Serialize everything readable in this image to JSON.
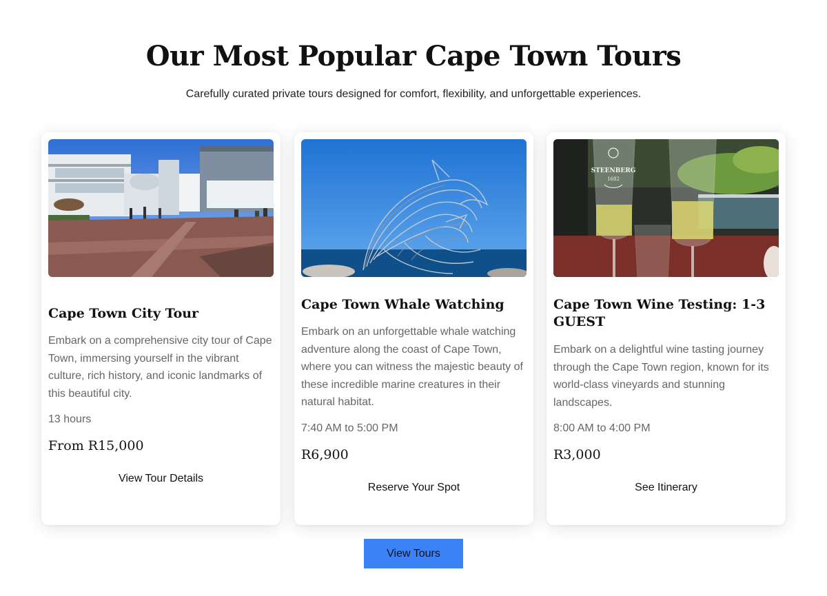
{
  "section": {
    "title": "Our Most Popular Cape Town Tours",
    "subtitle": "Carefully curated private tours designed for comfort, flexibility, and unforgettable experiences."
  },
  "tours": [
    {
      "image": "cape-town-waterfront-photo",
      "title": "Cape Town City Tour",
      "description": "Embark on a comprehensive city tour of Cape Town, immersing yourself in the vibrant culture, rich history, and iconic landmarks of this beautiful city.",
      "duration": "13 hours",
      "price": "From R15,000",
      "action": "View Tour Details"
    },
    {
      "image": "dolphin-sculpture-photo",
      "title": "Cape Town Whale Watching",
      "description": "Embark on an unforgettable whale watching adventure along the coast of Cape Town, where you can witness the majestic beauty of these incredible marine creatures in their natural habitat.",
      "duration": "7:40 AM to 5:00 PM",
      "price": "R6,900",
      "action": "Reserve Your Spot"
    },
    {
      "image": "wine-glasses-photo",
      "title": "Cape Town Wine Testing: 1-3 GUEST",
      "description": "Embark on a delightful wine tasting journey through the Cape Town region, known for its world-class vineyards and stunning landscapes.",
      "duration": "8:00 AM to 4:00 PM",
      "price": "R3,000",
      "action": "See Itinerary",
      "glass_print": [
        "STEENBERG",
        "1682"
      ]
    }
  ],
  "cta": {
    "label": "View Tours"
  },
  "colors": {
    "accent": "#3b82f6",
    "muted_text": "#666666",
    "heading": "#111111"
  }
}
